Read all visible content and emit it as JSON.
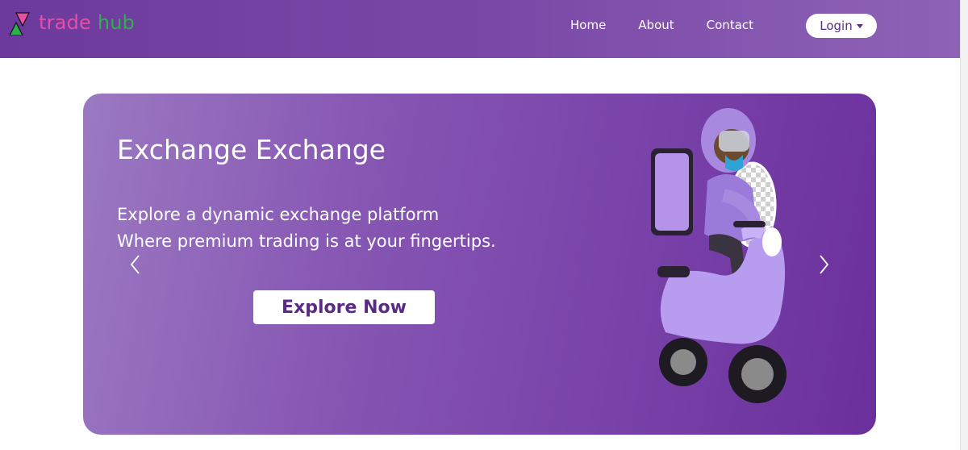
{
  "brand": {
    "name_part1": "trade",
    "name_part2": "hub",
    "logo_icon": "triangles-logo-icon",
    "colors": {
      "trade": "#e94ea6",
      "hub": "#2bb24c"
    }
  },
  "nav": {
    "items": [
      {
        "label": "Home"
      },
      {
        "label": "About"
      },
      {
        "label": "Contact"
      }
    ],
    "login_label": "Login",
    "login_icon": "caret-down-icon"
  },
  "hero": {
    "title": "Exchange Exchange",
    "line1": "Explore a dynamic exchange platform",
    "line2": "Where premium trading is at your fingertips.",
    "cta_label": "Explore Now",
    "prev_icon": "chevron-left-icon",
    "next_icon": "chevron-right-icon",
    "illustration": "scooter-delivery-rider-illustration"
  },
  "colors": {
    "navbar": "#7b4aa8",
    "hero_start": "#9b79c2",
    "hero_end": "#6b2f9c",
    "accent_text": "#5a2b86"
  }
}
